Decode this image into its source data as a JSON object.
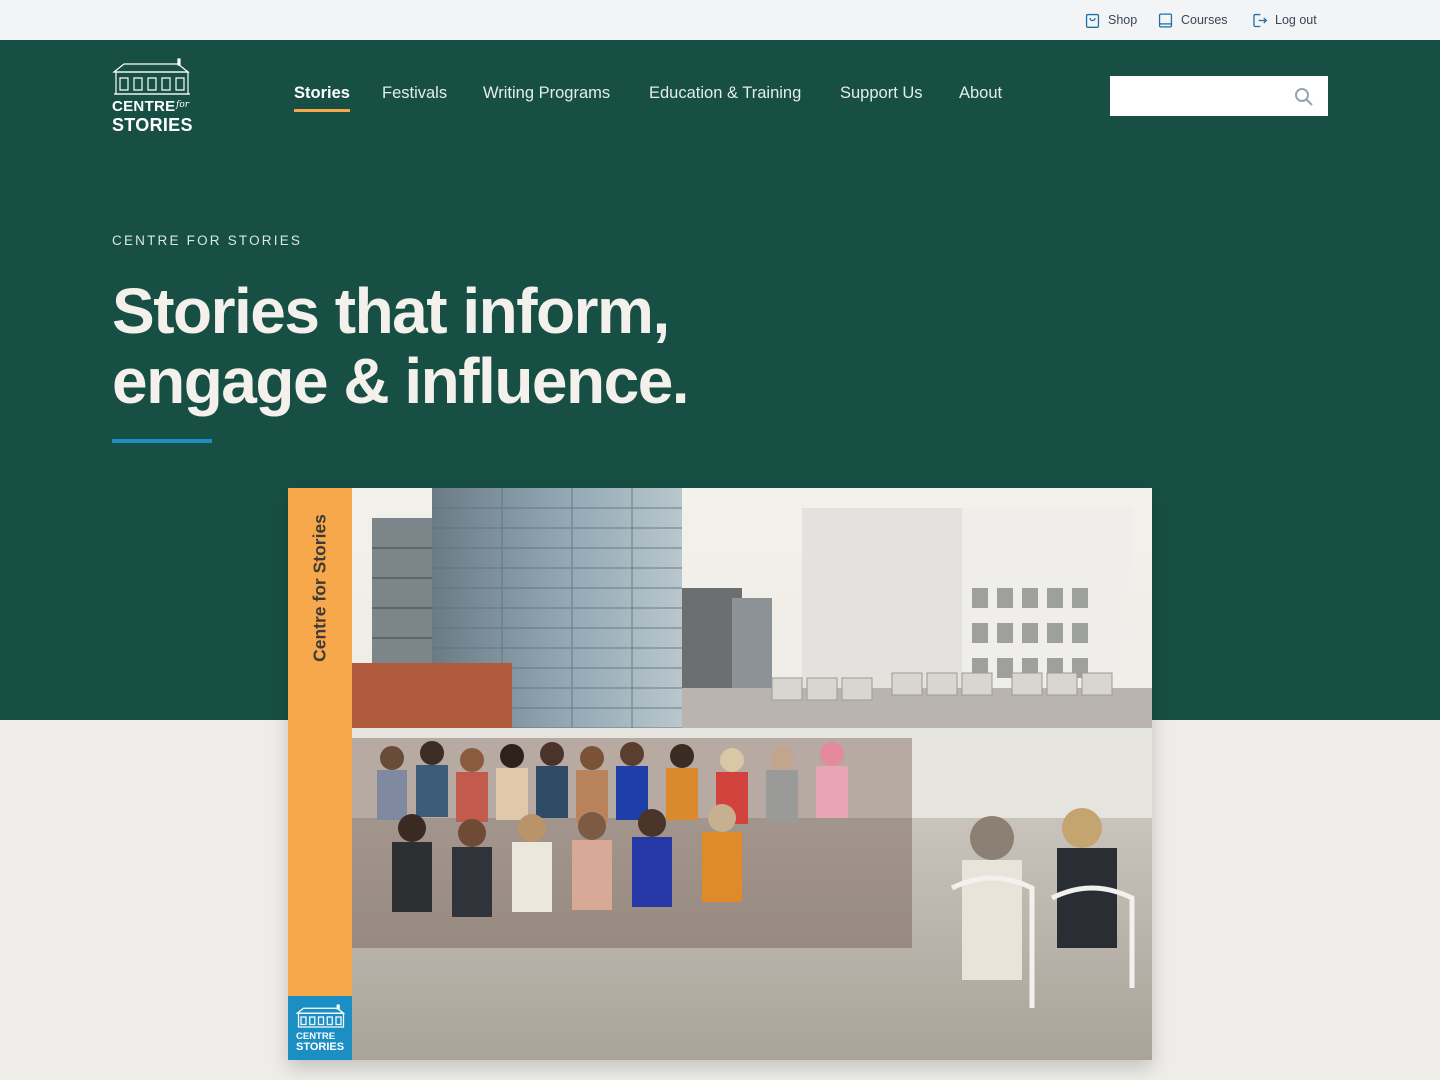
{
  "utility": {
    "shop_label": "Shop",
    "courses_label": "Courses",
    "logout_label": "Log out"
  },
  "logo": {
    "line1": "CENTRE",
    "for": "for",
    "line2": "STORIES"
  },
  "nav": {
    "items": [
      "Stories",
      "Festivals",
      "Writing Programs",
      "Education & Training",
      "Support Us",
      "About"
    ],
    "active": "Stories"
  },
  "search": {
    "value": "",
    "placeholder": ""
  },
  "hero": {
    "eyebrow": "CENTRE FOR STORIES",
    "headline_line1": "Stories that inform,",
    "headline_line2": "engage & influence."
  },
  "card": {
    "strip_title": "Centre for Stories",
    "strip_logo_line1": "CENTRE",
    "strip_logo_line2": "STORIES"
  },
  "colors": {
    "hero_bg": "#174f44",
    "accent_orange": "#f7a84b",
    "accent_blue": "#1c8ec6",
    "page_bg": "#efede9",
    "utility_bg": "#f2f4f6"
  }
}
